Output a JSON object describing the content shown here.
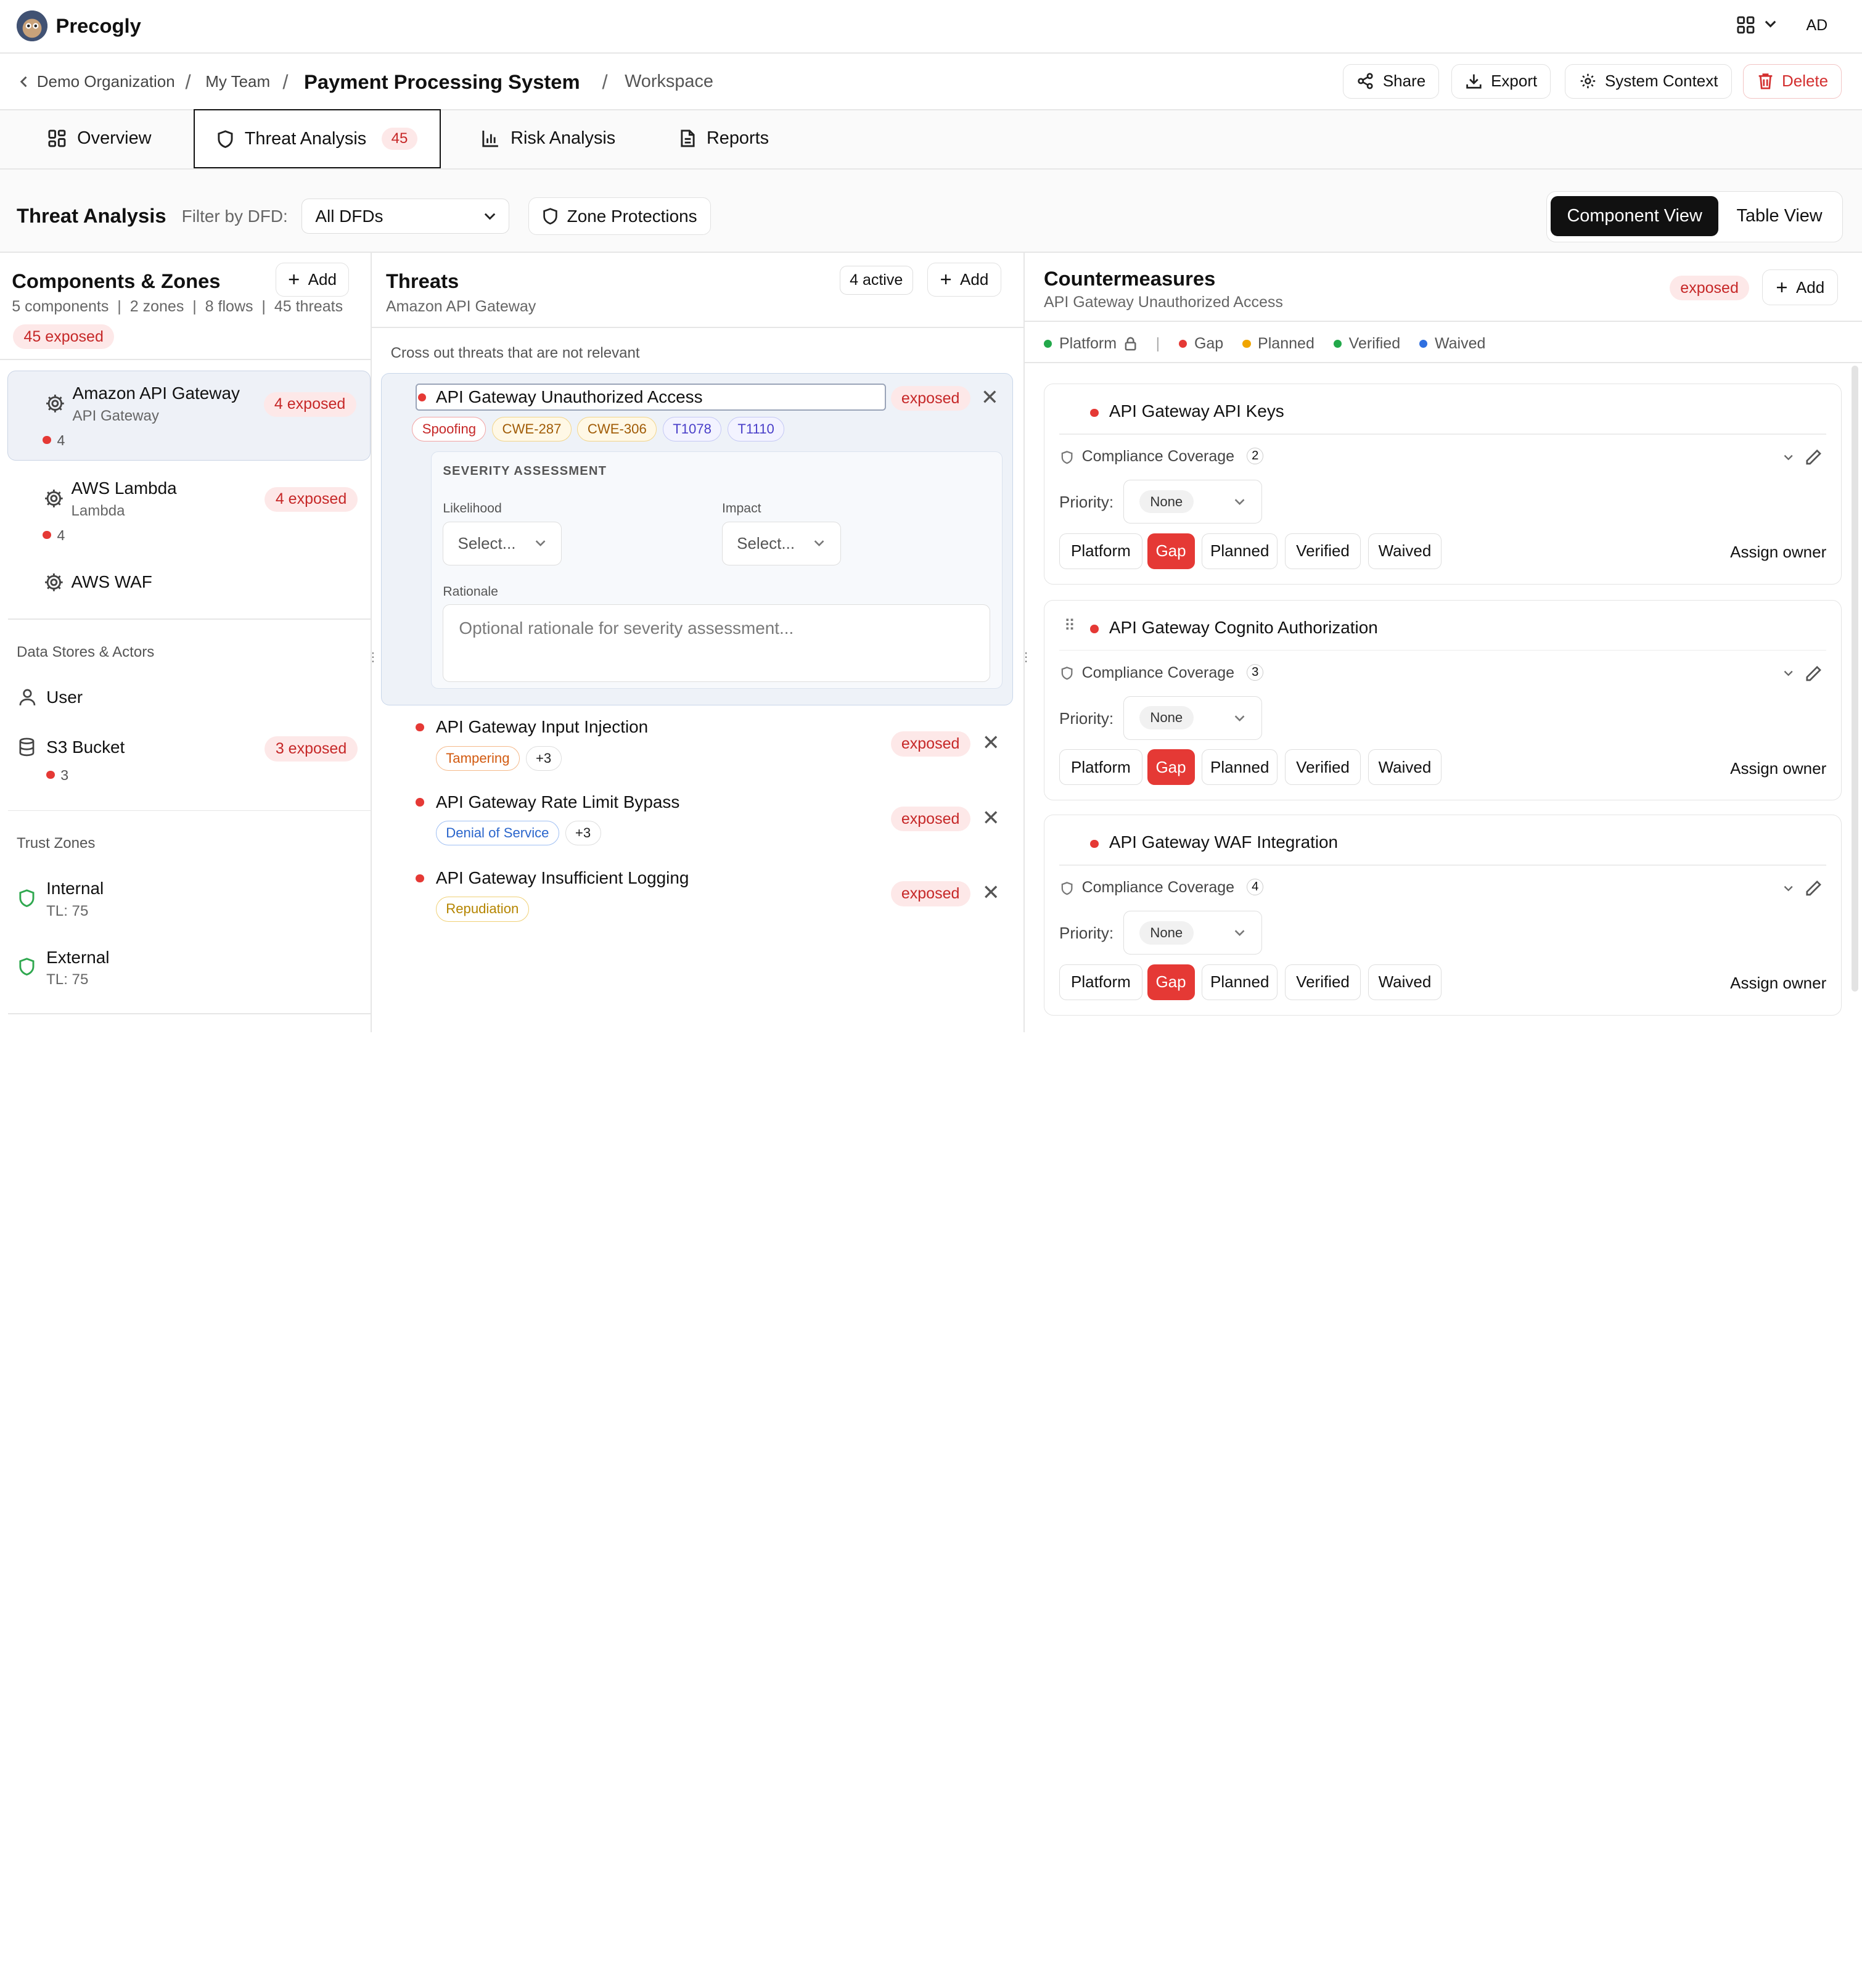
{
  "app": {
    "name": "Precogly",
    "user_initials": "AD"
  },
  "breadcrumb": {
    "org": "Demo Organization",
    "team": "My Team",
    "system": "Payment Processing System",
    "page": "Workspace"
  },
  "header_actions": {
    "share": "Share",
    "export": "Export",
    "system_context": "System Context",
    "delete": "Delete"
  },
  "tabs": [
    {
      "label": "Overview"
    },
    {
      "label": "Threat Analysis",
      "count": "45"
    },
    {
      "label": "Risk Analysis"
    },
    {
      "label": "Reports"
    }
  ],
  "toolbar": {
    "title": "Threat Analysis",
    "filter_label": "Filter by DFD:",
    "filter_value": "All DFDs",
    "zone_protections": "Zone Protections",
    "component_view": "Component View",
    "table_view": "Table View"
  },
  "components_panel": {
    "title": "Components & Zones",
    "add": "Add",
    "stats": {
      "components": "5 components",
      "zones": "2 zones",
      "flows": "8 flows",
      "threats": "45 threats"
    },
    "exposed_badge": "45 exposed",
    "components": [
      {
        "name": "Amazon API Gateway",
        "type": "API Gateway",
        "badge": "4 exposed",
        "count": "4"
      },
      {
        "name": "AWS Lambda",
        "type": "Lambda",
        "badge": "4 exposed",
        "count": "4"
      },
      {
        "name": "AWS WAF"
      }
    ],
    "stores_heading": "Data Stores & Actors",
    "stores": [
      {
        "name": "User"
      },
      {
        "name": "S3 Bucket",
        "badge": "3 exposed",
        "count": "3"
      }
    ],
    "zones_heading": "Trust Zones",
    "zones": [
      {
        "name": "Internal",
        "tl": "TL: 75"
      },
      {
        "name": "External",
        "tl": "TL: 75"
      }
    ]
  },
  "threats_panel": {
    "title": "Threats",
    "subtitle": "Amazon API Gateway",
    "active": "4 active",
    "add": "Add",
    "hint": "Cross out threats that are not relevant",
    "selected": {
      "title": "API Gateway Unauthorized Access",
      "status": "exposed",
      "tags": [
        "Spoofing",
        "CWE-287",
        "CWE-306",
        "T1078",
        "T1110"
      ],
      "severity_heading": "SEVERITY ASSESSMENT",
      "likelihood_label": "Likelihood",
      "likelihood_value": "Select...",
      "impact_label": "Impact",
      "impact_value": "Select...",
      "rationale_label": "Rationale",
      "rationale_placeholder": "Optional rationale for severity assessment..."
    },
    "threats": [
      {
        "title": "API Gateway Input Injection",
        "tag": "Tampering",
        "more": "+3",
        "status": "exposed"
      },
      {
        "title": "API Gateway Rate Limit Bypass",
        "tag": "Denial of Service",
        "more": "+3",
        "status": "exposed"
      },
      {
        "title": "API Gateway Insufficient Logging",
        "tag": "Repudiation",
        "status": "exposed"
      }
    ]
  },
  "countermeasures_panel": {
    "title": "Countermeasures",
    "subtitle": "API Gateway Unauthorized Access",
    "status": "exposed",
    "add": "Add",
    "legend": {
      "platform": "Platform",
      "gap": "Gap",
      "planned": "Planned",
      "verified": "Verified",
      "waived": "Waived"
    },
    "colors": {
      "platform": "#22a84a",
      "gap": "#e53935",
      "planned": "#f0a500",
      "verified": "#22a84a",
      "waived": "#2f6fe0"
    },
    "items": [
      {
        "title": "API Gateway API Keys",
        "coverage_label": "Compliance Coverage",
        "coverage": "2",
        "priority_label": "Priority:",
        "priority": "None",
        "states": [
          "Platform",
          "Gap",
          "Planned",
          "Verified",
          "Waived"
        ],
        "assign": "Assign owner"
      },
      {
        "title": "API Gateway Cognito Authorization",
        "coverage_label": "Compliance Coverage",
        "coverage": "3",
        "priority_label": "Priority:",
        "priority": "None",
        "states": [
          "Platform",
          "Gap",
          "Planned",
          "Verified",
          "Waived"
        ],
        "assign": "Assign owner"
      },
      {
        "title": "API Gateway WAF Integration",
        "coverage_label": "Compliance Coverage",
        "coverage": "4",
        "priority_label": "Priority:",
        "priority": "None",
        "states": [
          "Platform",
          "Gap",
          "Planned",
          "Verified",
          "Waived"
        ],
        "assign": "Assign owner"
      }
    ]
  }
}
